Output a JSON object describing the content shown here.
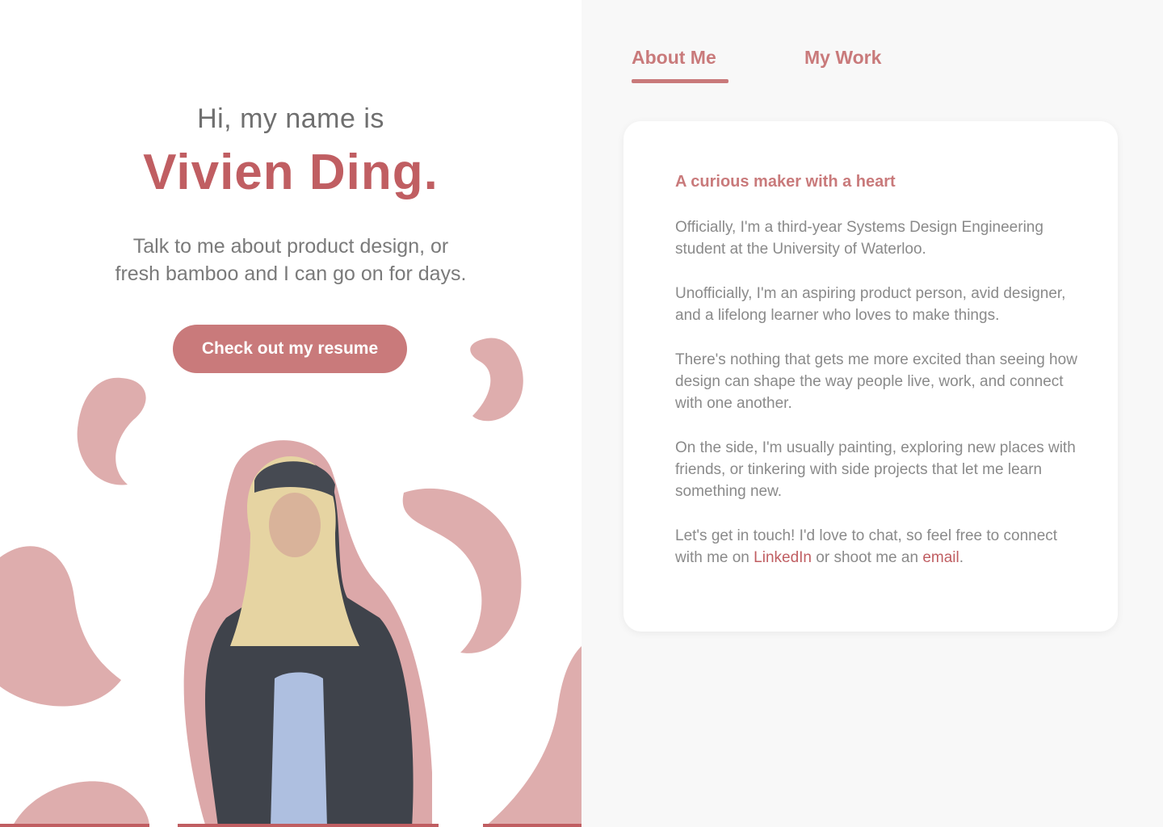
{
  "left": {
    "greeting": "Hi, my name is",
    "name": "Vivien Ding.",
    "tagline": "Talk to me about product design, or fresh bamboo and I can go on for days.",
    "cta_label": "Check out my resume",
    "accent_color": "#c97a7b"
  },
  "tabs": [
    {
      "label": "About Me",
      "active": true
    },
    {
      "label": "My Work",
      "active": false
    }
  ],
  "about": {
    "title": "A curious maker with a heart",
    "paragraphs": [
      "Officially, I'm a third-year Systems Design Engineering student at the University of Waterloo.",
      "Unofficially, I'm an aspiring product person, avid designer, and a lifelong learner who loves to make things.",
      "There's nothing that gets me more excited than seeing how design can shape the way people live, work, and connect with one another.",
      "On the side, I'm usually painting, exploring new places with friends, or tinkering with side projects that let me learn something new."
    ],
    "closing_before": "Let's get in touch! I'd love to chat, so feel free to connect with me on",
    "link_linkedin": "LinkedIn",
    "closing_middle": "or shoot me an",
    "link_email": "email",
    "closing_after": "."
  }
}
